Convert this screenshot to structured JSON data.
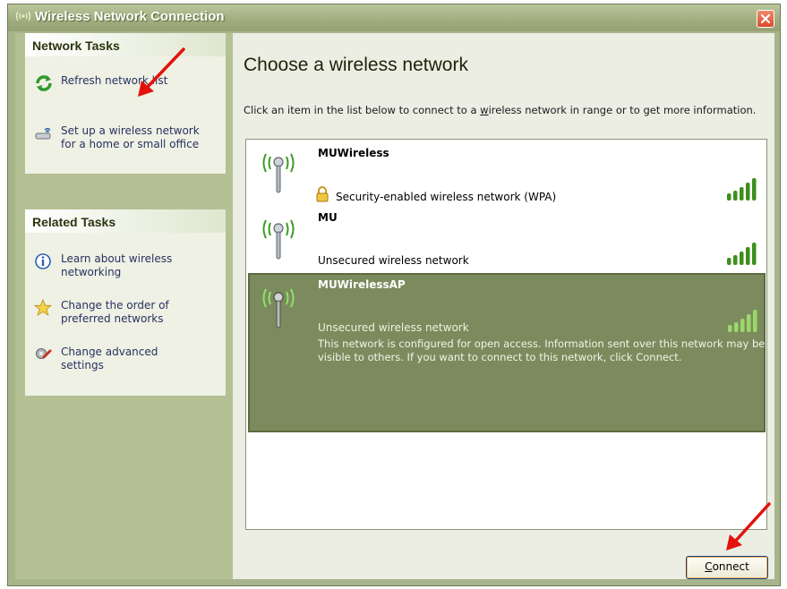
{
  "window": {
    "title": "Wireless Network Connection",
    "title_icon": "wireless-signal-icon",
    "close_icon": "close-icon"
  },
  "sidebar": {
    "network_tasks": {
      "header": "Network Tasks",
      "items": [
        {
          "label": "Refresh network list",
          "icon": "refresh-icon"
        },
        {
          "label": "Set up a wireless network\nfor a home or small office",
          "icon": "wireless-setup-icon"
        }
      ]
    },
    "related_tasks": {
      "header": "Related Tasks",
      "items": [
        {
          "label": "Learn about wireless\nnetworking",
          "icon": "info-icon"
        },
        {
          "label": "Change the order of\npreferred networks",
          "icon": "star-icon"
        },
        {
          "label": "Change advanced\nsettings",
          "icon": "settings-icon"
        }
      ]
    }
  },
  "main": {
    "title": "Choose a wireless network",
    "description_pre": "Click an item in the list below to connect to a ",
    "description_link": "w",
    "description_post": "ireless network in range or to get more information.",
    "networks": [
      {
        "name": "MUWireless",
        "security": "Security-enabled wireless network (WPA)",
        "secured": true,
        "signal_bars": 5,
        "selected": false
      },
      {
        "name": "MU",
        "security": "Unsecured wireless network",
        "secured": false,
        "signal_bars": 5,
        "selected": false
      },
      {
        "name": "MUWirelessAP",
        "security": "Unsecured wireless network",
        "secured": false,
        "signal_bars": 5,
        "selected": true,
        "detail": "This network is configured for open access. Information sent over this network may be visible to others. If you want to connect to this network, click Connect."
      }
    ],
    "connect_label_underlined": "C",
    "connect_label_rest": "onnect"
  },
  "colors": {
    "accent": "#a8b48c",
    "selected_row": "#7c8b5e",
    "signal_green": "#3e8e1c",
    "annotation_arrow": "#e3120b"
  }
}
